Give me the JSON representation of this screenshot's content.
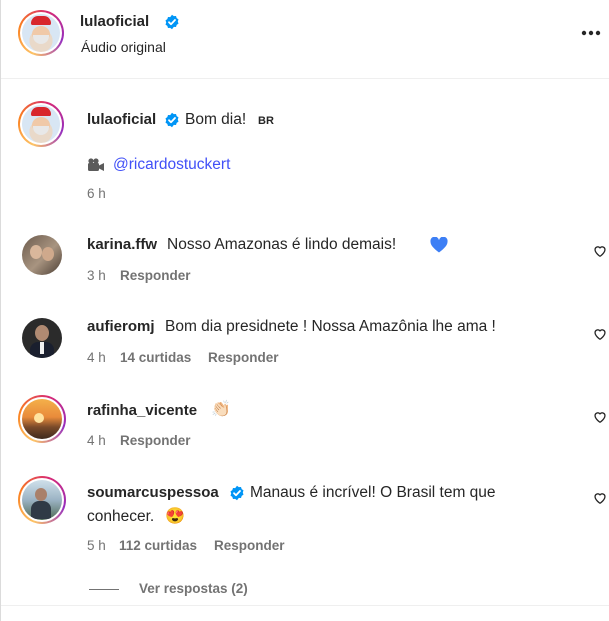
{
  "header": {
    "username": "lulaoficial",
    "subtitle": "Áudio original",
    "more_label": "•••"
  },
  "caption": {
    "username": "lulaoficial",
    "text": "Bom dia!",
    "flag": "BR",
    "credit_handle": "@ricardostuckert",
    "time": "6 h"
  },
  "comments": [
    {
      "username": "karina.ffw",
      "text": "Nosso Amazonas é lindo demais!",
      "emoji": "💙",
      "time": "3 h",
      "likes": "",
      "reply": "Responder"
    },
    {
      "username": "aufieromj",
      "text": "Bom dia presidnete ! Nossa Amazônia lhe ama !",
      "emoji": "",
      "time": "4 h",
      "likes": "14 curtidas",
      "reply": "Responder"
    },
    {
      "username": "rafinha_vicente",
      "text": "",
      "emoji": "👏🏻",
      "time": "4 h",
      "likes": "",
      "reply": "Responder"
    },
    {
      "username": "soumarcuspessoa",
      "text_line1": "Manaus é incrível! O Brasil tem que",
      "text_line2": "conhecer.",
      "emoji": "😍",
      "time": "5 h",
      "likes": "112 curtidas",
      "reply": "Responder",
      "verified": true
    }
  ],
  "view_replies": "Ver respostas (2)",
  "colors": {
    "verified": "#0095f6",
    "link": "#4150f7",
    "meta": "#737373"
  }
}
